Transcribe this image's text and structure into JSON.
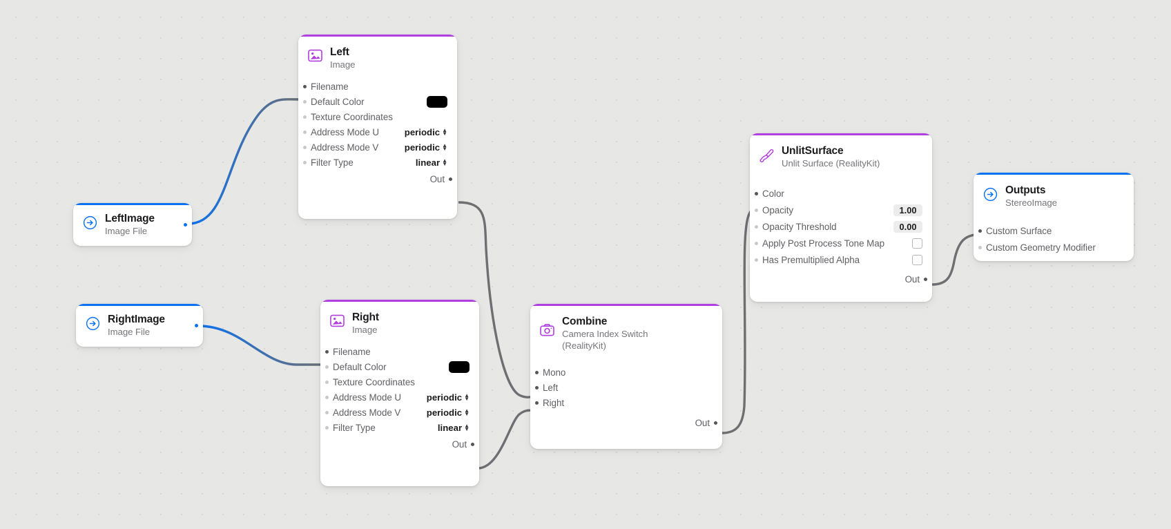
{
  "app": {
    "canvas_name": "shader-graph-canvas"
  },
  "colors": {
    "accent_purple": "#b13ee0",
    "accent_blue": "#0a72f0",
    "wire_gray": "#6e6e73",
    "canvas_bg": "#e7e7e5",
    "node_bg": "#ffffff",
    "swatch_black": "#000000"
  },
  "nodes": {
    "left_image": {
      "title": "LeftImage",
      "subtitle": "Image File",
      "icon": "arrow-right-circle-icon",
      "out_label": ""
    },
    "right_image": {
      "title": "RightImage",
      "subtitle": "Image File",
      "icon": "arrow-right-circle-icon",
      "out_label": ""
    },
    "left": {
      "title": "Left",
      "subtitle": "Image",
      "icon": "image-icon",
      "out_label": "Out",
      "ports": [
        {
          "label": "Filename",
          "connected": true,
          "control": "none"
        },
        {
          "label": "Default Color",
          "connected": false,
          "control": "swatch",
          "value": "#000000"
        },
        {
          "label": "Texture Coordinates",
          "connected": false,
          "control": "none"
        },
        {
          "label": "Address Mode U",
          "connected": false,
          "control": "stepper",
          "value": "periodic"
        },
        {
          "label": "Address Mode V",
          "connected": false,
          "control": "stepper",
          "value": "periodic"
        },
        {
          "label": "Filter Type",
          "connected": false,
          "control": "stepper",
          "value": "linear"
        }
      ]
    },
    "right": {
      "title": "Right",
      "subtitle": "Image",
      "icon": "image-icon",
      "out_label": "Out",
      "ports": [
        {
          "label": "Filename",
          "connected": true,
          "control": "none"
        },
        {
          "label": "Default Color",
          "connected": false,
          "control": "swatch",
          "value": "#000000"
        },
        {
          "label": "Texture Coordinates",
          "connected": false,
          "control": "none"
        },
        {
          "label": "Address Mode U",
          "connected": false,
          "control": "stepper",
          "value": "periodic"
        },
        {
          "label": "Address Mode V",
          "connected": false,
          "control": "stepper",
          "value": "periodic"
        },
        {
          "label": "Filter Type",
          "connected": false,
          "control": "stepper",
          "value": "linear"
        }
      ]
    },
    "combine": {
      "title": "Combine",
      "subtitle": "Camera Index Switch",
      "subtitle2": "(RealityKit)",
      "icon": "camera-icon",
      "out_label": "Out",
      "ports": [
        {
          "label": "Mono",
          "connected": true,
          "control": "none"
        },
        {
          "label": "Left",
          "connected": true,
          "control": "none"
        },
        {
          "label": "Right",
          "connected": true,
          "control": "none"
        }
      ]
    },
    "unlit_surface": {
      "title": "UnlitSurface",
      "subtitle": "Unlit Surface (RealityKit)",
      "icon": "paintbrush-icon",
      "out_label": "Out",
      "ports": [
        {
          "label": "Color",
          "connected": true,
          "control": "none"
        },
        {
          "label": "Opacity",
          "connected": false,
          "control": "number",
          "value": "1.00"
        },
        {
          "label": "Opacity Threshold",
          "connected": false,
          "control": "number",
          "value": "0.00"
        },
        {
          "label": "Apply Post Process Tone Map",
          "connected": false,
          "control": "checkbox",
          "value": false
        },
        {
          "label": "Has Premultiplied Alpha",
          "connected": false,
          "control": "checkbox",
          "value": false
        }
      ]
    },
    "outputs": {
      "title": "Outputs",
      "subtitle": "StereoImage",
      "icon": "arrow-right-circle-icon",
      "ports": [
        {
          "label": "Custom Surface",
          "connected": true,
          "control": "none"
        },
        {
          "label": "Custom Geometry Modifier",
          "connected": false,
          "control": "none"
        }
      ]
    }
  }
}
